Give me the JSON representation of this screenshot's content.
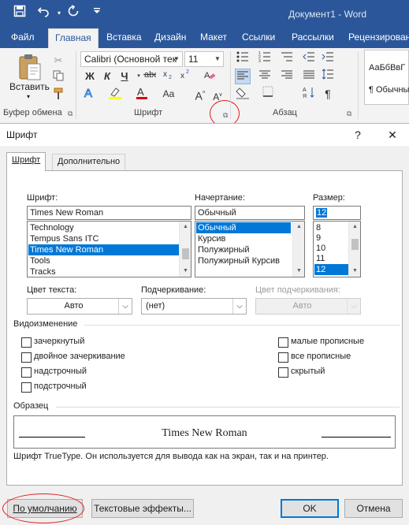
{
  "window": {
    "title": "Документ1 - Word"
  },
  "qat": {
    "save_icon": "save-icon",
    "undo_icon": "undo-icon",
    "redo_icon": "redo-icon",
    "customize_icon": "customize-icon"
  },
  "ribbon_tabs": [
    "Файл",
    "Главная",
    "Вставка",
    "Дизайн",
    "Макет",
    "Ссылки",
    "Рассылки",
    "Рецензирован"
  ],
  "ribbon": {
    "paste_label": "Вставить",
    "font_name": "Calibri (Основной тек",
    "font_size": "11",
    "bold": "Ж",
    "italic": "К",
    "underline": "Ч",
    "style_sample": "АаБбВвГ",
    "style_name": "¶ Обычный",
    "groups": {
      "clipboard": "Буфер обмена",
      "font": "Шрифт",
      "paragraph": "Абзац"
    }
  },
  "dialog": {
    "title": "Шрифт",
    "help": "?",
    "close": "✕",
    "tabs": [
      "Шрифт",
      "Дополнительно"
    ],
    "font": {
      "label": "Шрифт:",
      "value": "Times New Roman",
      "options": [
        "Technology",
        "Tempus Sans ITC",
        "Times New Roman",
        "Tools",
        "Tracks"
      ],
      "selected_index": 2
    },
    "style": {
      "label": "Начертание:",
      "value": "Обычный",
      "options": [
        "Обычный",
        "Курсив",
        "Полужирный",
        "Полужирный Курсив"
      ],
      "selected_index": 0
    },
    "size": {
      "label": "Размер:",
      "value": "12",
      "options": [
        "8",
        "9",
        "10",
        "11",
        "12"
      ],
      "selected_index": 4
    },
    "font_color": {
      "label": "Цвет текста:",
      "value": "Авто"
    },
    "underline": {
      "label": "Подчеркивание:",
      "value": "(нет)"
    },
    "underline_color": {
      "label": "Цвет подчеркивания:",
      "value": "Авто"
    },
    "effects": {
      "title": "Видоизменение",
      "left": [
        {
          "label": "зачеркнутый",
          "checked": false
        },
        {
          "label": "двойное зачеркивание",
          "checked": false
        },
        {
          "label": "надстрочный",
          "checked": false
        },
        {
          "label": "подстрочный",
          "checked": false
        }
      ],
      "right": [
        {
          "label": "малые прописные",
          "checked": false
        },
        {
          "label": "все прописные",
          "checked": false
        },
        {
          "label": "скрытый",
          "checked": false
        }
      ]
    },
    "preview": {
      "title": "Образец",
      "text": "Times New Roman",
      "note": "Шрифт TrueType. Он используется для вывода как на экран, так и на принтер."
    },
    "buttons": {
      "default": "По умолчанию",
      "text_effects": "Текстовые эффекты...",
      "ok": "OK",
      "cancel": "Отмена"
    }
  }
}
